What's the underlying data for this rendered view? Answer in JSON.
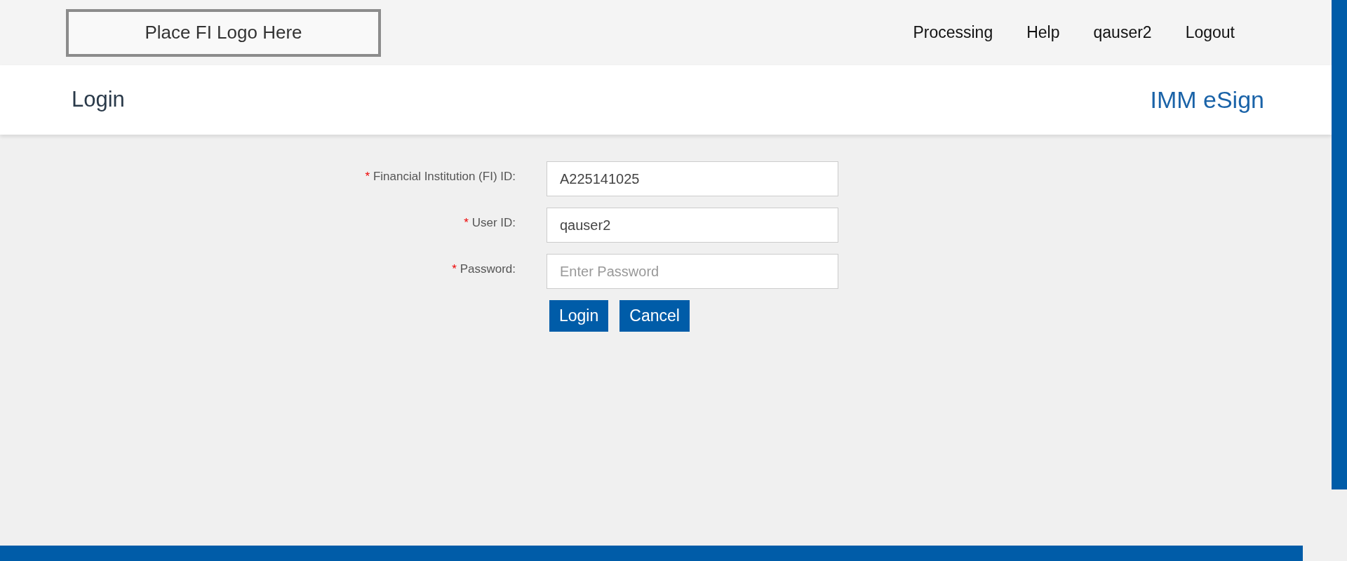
{
  "header": {
    "logo_text": "Place FI Logo Here",
    "nav": [
      {
        "label": "Processing"
      },
      {
        "label": "Help"
      },
      {
        "label": "qauser2"
      },
      {
        "label": "Logout"
      }
    ]
  },
  "title_bar": {
    "title": "Login",
    "app_name": "IMM eSign"
  },
  "form": {
    "fields": [
      {
        "label": "Financial Institution (FI) ID:",
        "required_mark": "*",
        "value": "A225141025"
      },
      {
        "label": "User ID:",
        "required_mark": "*",
        "value": "qauser2"
      },
      {
        "label": "Password:",
        "required_mark": "*",
        "placeholder": "Enter Password"
      }
    ],
    "buttons": [
      "Login",
      "Cancel"
    ]
  }
}
